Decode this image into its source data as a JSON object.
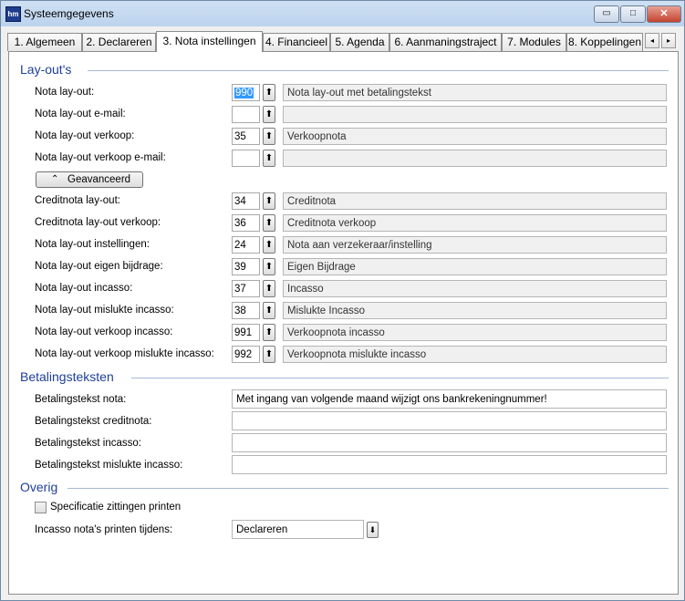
{
  "window": {
    "title": "Systeemgegevens",
    "minimize": "▭",
    "maximize": "□",
    "close": "✕"
  },
  "tabs": [
    {
      "label": "1. Algemeen"
    },
    {
      "label": "2. Declareren"
    },
    {
      "label": "3. Nota instellingen"
    },
    {
      "label": "4. Financieel"
    },
    {
      "label": "5. Agenda"
    },
    {
      "label": "6. Aanmaningstraject"
    },
    {
      "label": "7. Modules"
    },
    {
      "label": "8. Koppelingen"
    }
  ],
  "sections": {
    "layouts": "Lay-out's",
    "payment_texts": "Betalingsteksten",
    "other": "Overig"
  },
  "layout_rows": [
    {
      "label": "Nota lay-out:",
      "code": "990",
      "description": "Nota lay-out met betalingstekst"
    },
    {
      "label": "Nota lay-out e-mail:",
      "code": "",
      "description": ""
    },
    {
      "label": "Nota lay-out verkoop:",
      "code": "35",
      "description": "Verkoopnota"
    },
    {
      "label": "Nota lay-out verkoop e-mail:",
      "code": "",
      "description": ""
    }
  ],
  "advanced_button": "Geavanceerd",
  "advanced_rows": [
    {
      "label": "Creditnota lay-out:",
      "code": "34",
      "description": "Creditnota"
    },
    {
      "label": "Creditnota lay-out verkoop:",
      "code": "36",
      "description": "Creditnota verkoop"
    },
    {
      "label": "Nota lay-out instellingen:",
      "code": "24",
      "description": "Nota aan verzekeraar/instelling"
    },
    {
      "label": "Nota lay-out  eigen bijdrage:",
      "code": "39",
      "description": "Eigen Bijdrage"
    },
    {
      "label": "Nota lay-out incasso:",
      "code": "37",
      "description": "Incasso"
    },
    {
      "label": "Nota lay-out mislukte incasso:",
      "code": "38",
      "description": "Mislukte Incasso"
    },
    {
      "label": "Nota lay-out verkoop incasso:",
      "code": "991",
      "description": "Verkoopnota incasso"
    },
    {
      "label": "Nota lay-out verkoop mislukte incasso:",
      "code": "992",
      "description": "Verkoopnota mislukte incasso"
    }
  ],
  "payment_rows": [
    {
      "label": "Betalingstekst nota:",
      "value": "Met ingang van volgende maand wijzigt ons bankrekeningnummer!"
    },
    {
      "label": "Betalingstekst creditnota:",
      "value": ""
    },
    {
      "label": "Betalingstekst incasso:",
      "value": ""
    },
    {
      "label": "Betalingstekst mislukte incasso:",
      "value": ""
    }
  ],
  "other": {
    "checkbox_label": "Specificatie zittingen printen",
    "checkbox_checked": false,
    "incasso_label": "Incasso nota's printen tijdens:",
    "incasso_value": "Declareren"
  },
  "icons": {
    "picker": "⬆",
    "chevron_up": "⌃",
    "scroll_left": "◂",
    "scroll_right": "▸",
    "combo_down": "⬇"
  }
}
